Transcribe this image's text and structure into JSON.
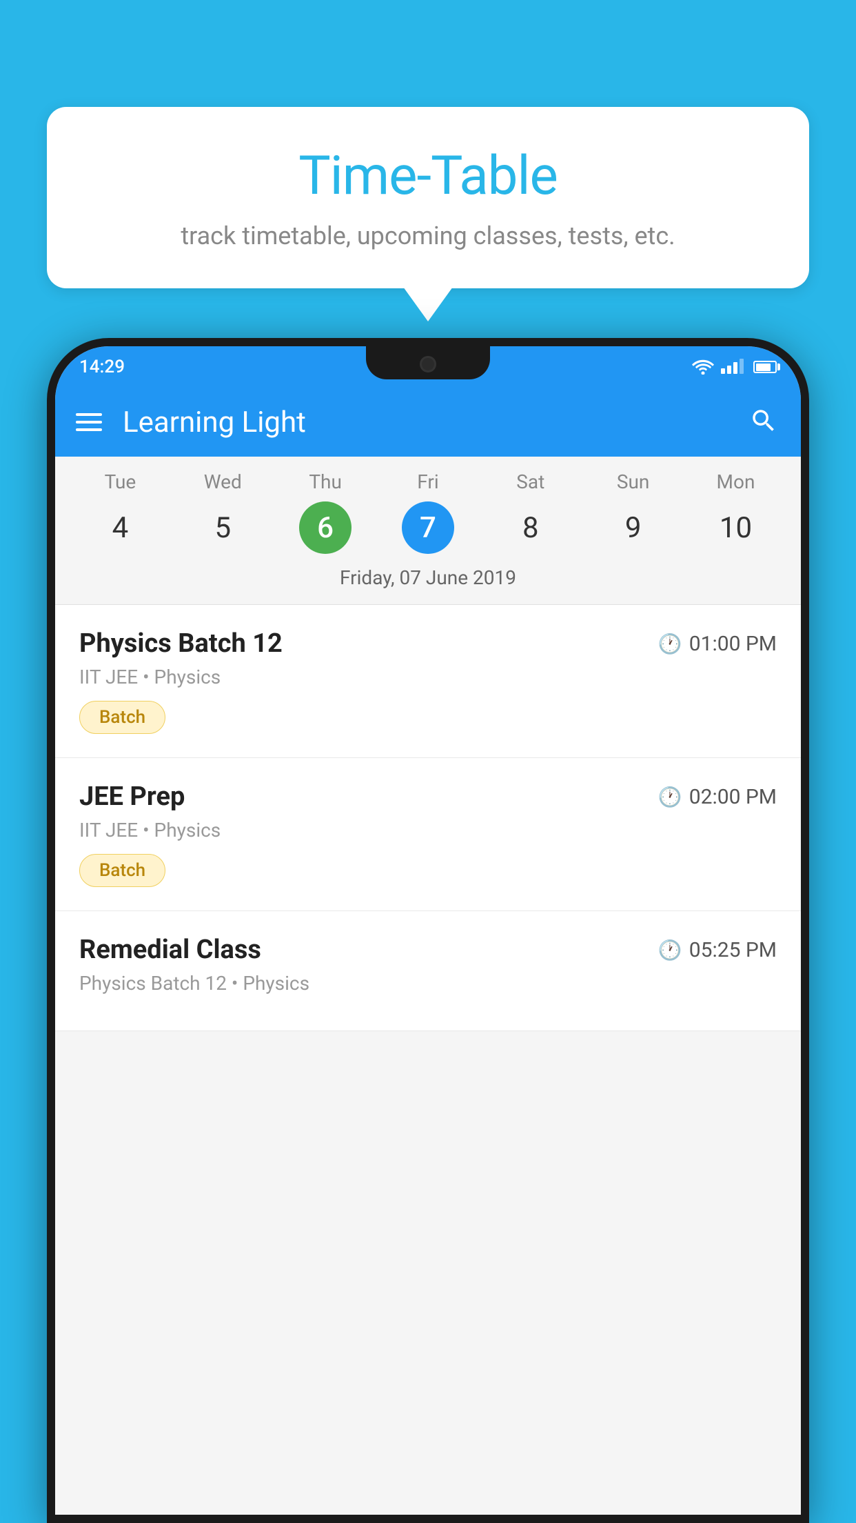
{
  "background_color": "#29b6e8",
  "speech_bubble": {
    "title": "Time-Table",
    "subtitle": "track timetable, upcoming classes, tests, etc."
  },
  "phone": {
    "status_bar": {
      "time": "14:29"
    },
    "app_bar": {
      "title": "Learning Light"
    },
    "calendar": {
      "days": [
        {
          "label": "Tue",
          "number": "4",
          "state": "normal"
        },
        {
          "label": "Wed",
          "number": "5",
          "state": "normal"
        },
        {
          "label": "Thu",
          "number": "6",
          "state": "today"
        },
        {
          "label": "Fri",
          "number": "7",
          "state": "selected"
        },
        {
          "label": "Sat",
          "number": "8",
          "state": "normal"
        },
        {
          "label": "Sun",
          "number": "9",
          "state": "normal"
        },
        {
          "label": "Mon",
          "number": "10",
          "state": "normal"
        }
      ],
      "selected_date_label": "Friday, 07 June 2019"
    },
    "schedule": [
      {
        "title": "Physics Batch 12",
        "time": "01:00 PM",
        "subtitle": "IIT JEE • Physics",
        "badge": "Batch"
      },
      {
        "title": "JEE Prep",
        "time": "02:00 PM",
        "subtitle": "IIT JEE • Physics",
        "badge": "Batch"
      },
      {
        "title": "Remedial Class",
        "time": "05:25 PM",
        "subtitle": "Physics Batch 12 • Physics",
        "badge": null
      }
    ]
  }
}
